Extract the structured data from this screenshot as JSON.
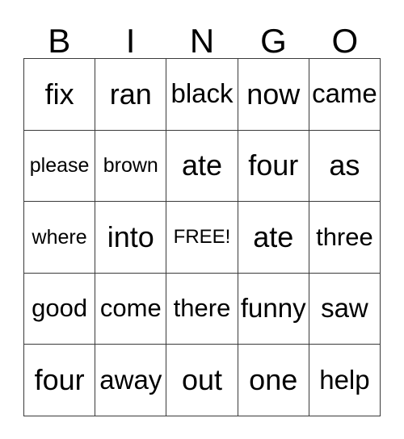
{
  "card": {
    "title": "BINGO",
    "header_letters": [
      "B",
      "I",
      "N",
      "G",
      "O"
    ],
    "free_space_label": "FREE!",
    "free_space_position": {
      "row": 2,
      "column": 2
    },
    "grid_size": "5x5",
    "colors": {
      "background": "#ffffff",
      "text": "#000000",
      "border": "#3a3a3a"
    },
    "rows": [
      {
        "cells": [
          {
            "text": "fix",
            "size": "sz-xl"
          },
          {
            "text": "ran",
            "size": "sz-xl"
          },
          {
            "text": "black",
            "size": "sz-lg"
          },
          {
            "text": "now",
            "size": "sz-xl"
          },
          {
            "text": "came",
            "size": "sz-lg"
          }
        ]
      },
      {
        "cells": [
          {
            "text": "please",
            "size": "sz-sm"
          },
          {
            "text": "brown",
            "size": "sz-sm"
          },
          {
            "text": "ate",
            "size": "sz-xl"
          },
          {
            "text": "four",
            "size": "sz-xl"
          },
          {
            "text": "as",
            "size": "sz-xl"
          }
        ]
      },
      {
        "cells": [
          {
            "text": "where",
            "size": "sz-sm"
          },
          {
            "text": "into",
            "size": "sz-xl"
          },
          {
            "text": "FREE!",
            "size": "sz-xs"
          },
          {
            "text": "ate",
            "size": "sz-xl"
          },
          {
            "text": "three",
            "size": "sz-md"
          }
        ]
      },
      {
        "cells": [
          {
            "text": "good",
            "size": "sz-md"
          },
          {
            "text": "come",
            "size": "sz-md"
          },
          {
            "text": "there",
            "size": "sz-md"
          },
          {
            "text": "funny",
            "size": "sz-lg"
          },
          {
            "text": "saw",
            "size": "sz-lg"
          }
        ]
      },
      {
        "cells": [
          {
            "text": "four",
            "size": "sz-xl"
          },
          {
            "text": "away",
            "size": "sz-lg"
          },
          {
            "text": "out",
            "size": "sz-xl"
          },
          {
            "text": "one",
            "size": "sz-xl"
          },
          {
            "text": "help",
            "size": "sz-lg"
          }
        ]
      }
    ]
  }
}
